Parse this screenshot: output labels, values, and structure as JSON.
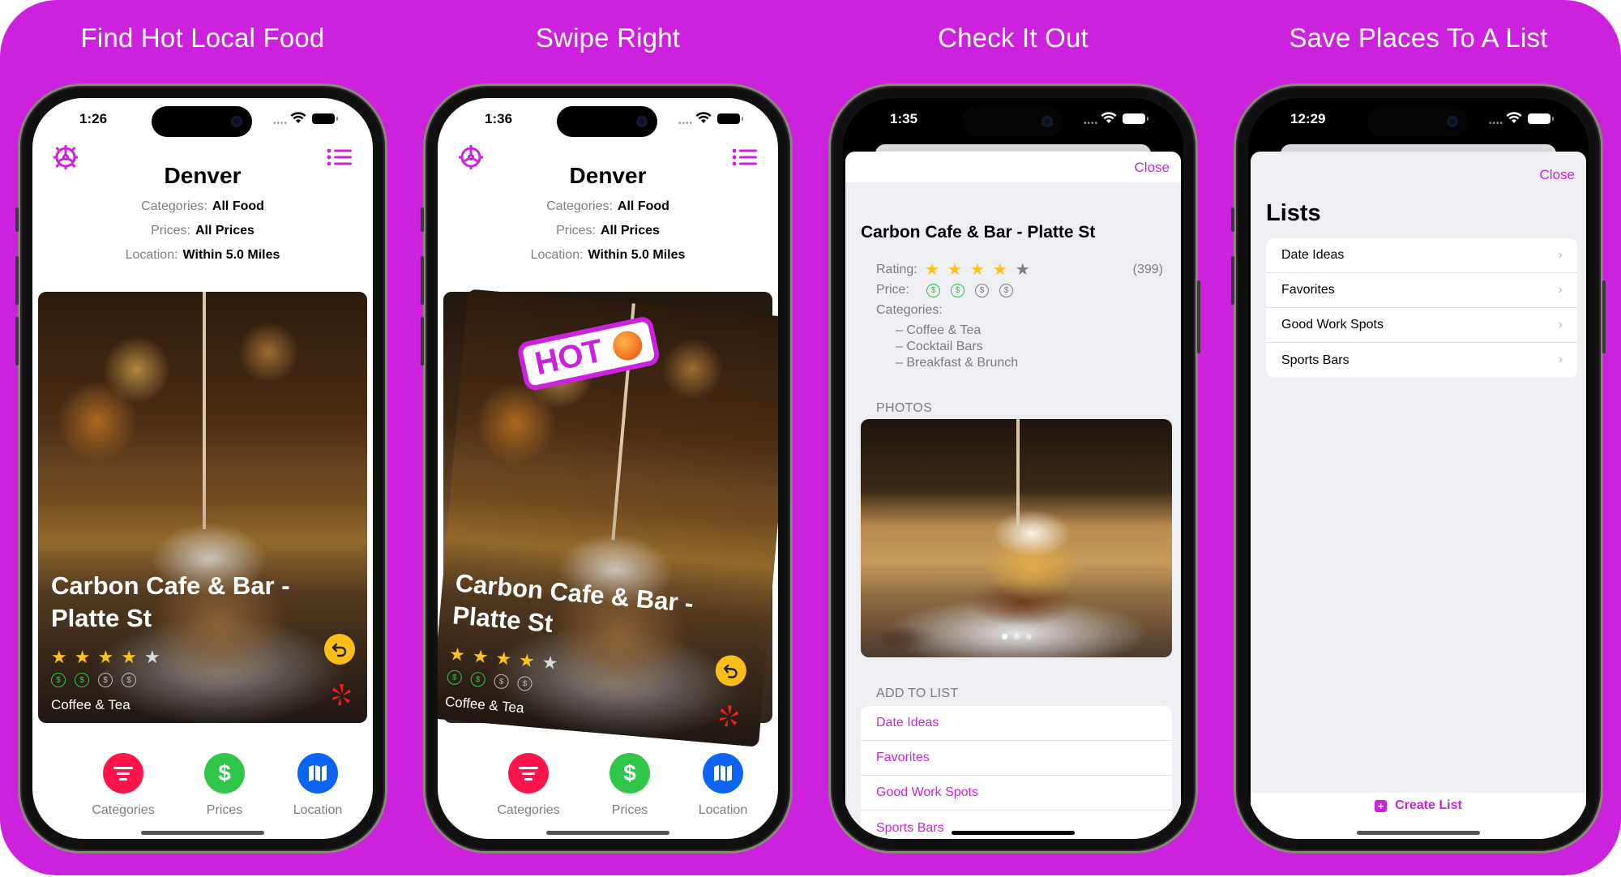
{
  "brand_color": "#cc22dd",
  "panels": [
    {
      "caption": "Find Hot Local Food",
      "status": {
        "time": "1:26"
      },
      "header": {
        "settings_icon": "gear-icon",
        "lists_icon": "list-bullet-icon",
        "city": "Denver",
        "filters": [
          {
            "label": "Categories:",
            "value": "All Food"
          },
          {
            "label": "Prices:",
            "value": "All Prices"
          },
          {
            "label": "Location:",
            "value": "Within 5.0 Miles"
          }
        ]
      },
      "card": {
        "title": "Carbon Cafe & Bar - Platte St",
        "rating": 4,
        "rating_max": 5,
        "price_level": 2,
        "price_max": 4,
        "category": "Coffee & Tea",
        "undo_icon": "undo-arrow-icon",
        "source_icon": "yelp-logo-icon"
      },
      "tabs": [
        {
          "label": "Categories",
          "icon": "filter-lines-icon",
          "color": "#ff1549"
        },
        {
          "label": "Prices",
          "icon": "dollar-icon",
          "color": "#2fc64a"
        },
        {
          "label": "Location",
          "icon": "map-icon",
          "color": "#0c64f5"
        }
      ]
    },
    {
      "caption": "Swipe Right",
      "status": {
        "time": "1:36"
      },
      "header": {
        "city": "Denver",
        "filters": [
          {
            "label": "Categories:",
            "value": "All Food"
          },
          {
            "label": "Prices:",
            "value": "All Prices"
          },
          {
            "label": "Location:",
            "value": "Within 5.0 Miles"
          }
        ]
      },
      "hot_badge": {
        "label": "HOT",
        "emoji_icon": "hot-face-emoji-icon"
      },
      "card": {
        "title": "Carbon Cafe & Bar - Platte St",
        "rating": 4,
        "rating_max": 5,
        "price_level": 2,
        "price_max": 4,
        "category": "Coffee & Tea"
      },
      "tabs": [
        {
          "label": "Categories",
          "color": "#ff1549"
        },
        {
          "label": "Prices",
          "color": "#2fc64a"
        },
        {
          "label": "Location",
          "color": "#0c64f5"
        }
      ]
    },
    {
      "caption": "Check It Out",
      "status": {
        "time": "1:35"
      },
      "close_label": "Close",
      "detail": {
        "title": "Carbon Cafe & Bar - Platte St",
        "rating_label": "Rating:",
        "rating": 4,
        "rating_max": 5,
        "review_count": "(399)",
        "price_label": "Price:",
        "price_level": 2,
        "price_max": 4,
        "categories_label": "Categories:",
        "categories": [
          "– Coffee & Tea",
          "– Cocktail Bars",
          "– Breakfast & Brunch"
        ],
        "photos_header": "PHOTOS",
        "photo_page": 1,
        "photo_count": 3,
        "add_to_list_header": "ADD TO LIST",
        "lists": [
          "Date Ideas",
          "Favorites",
          "Good Work Spots",
          "Sports Bars"
        ]
      }
    },
    {
      "caption": "Save Places To A List",
      "status": {
        "time": "12:29"
      },
      "close_label": "Close",
      "title": "Lists",
      "lists": [
        "Date Ideas",
        "Favorites",
        "Good Work Spots",
        "Sports Bars"
      ],
      "create_label": "Create List"
    }
  ]
}
